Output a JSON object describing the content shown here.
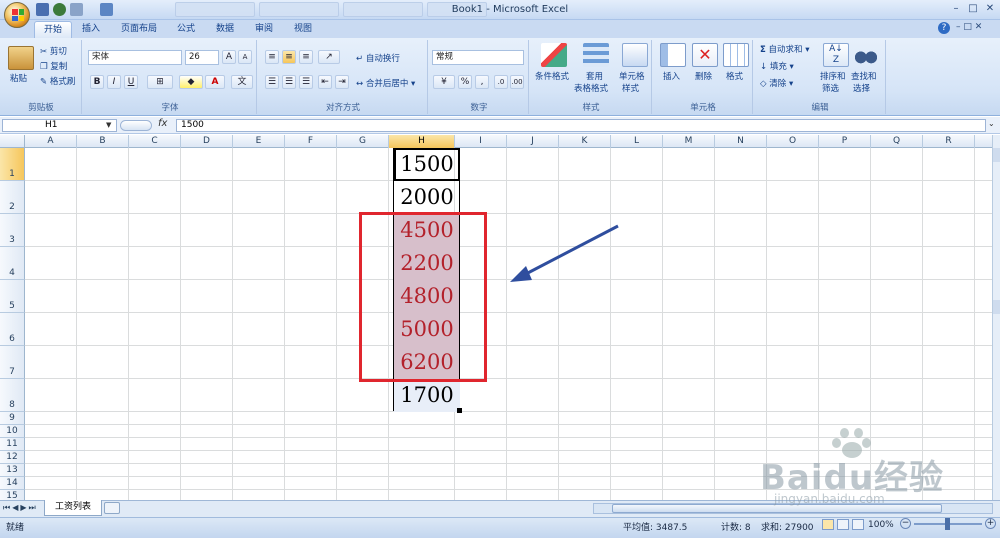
{
  "window": {
    "title": "Book1 - Microsoft Excel",
    "help_icon": "help-icon",
    "controls": [
      "minimize",
      "restore",
      "close"
    ]
  },
  "tabs": [
    "开始",
    "插入",
    "页面布局",
    "公式",
    "数据",
    "审阅",
    "视图"
  ],
  "active_tab": "开始",
  "ribbon": {
    "clipboard": {
      "paste": "粘贴",
      "cut": "剪切",
      "copy": "复制",
      "format_painter": "格式刷",
      "group_label": "剪贴板"
    },
    "font": {
      "font_name": "宋体",
      "font_size": "26",
      "bold": "B",
      "italic": "I",
      "underline": "U",
      "group_label": "字体"
    },
    "alignment": {
      "wrap_text": "自动换行",
      "merge_center": "合并后居中",
      "group_label": "对齐方式"
    },
    "number": {
      "format": "常规",
      "percent": "%",
      "comma": ",",
      "group_label": "数字"
    },
    "styles": {
      "conditional_format": "条件格式",
      "table_format_1": "套用",
      "table_format_2": "表格格式",
      "cell_styles_1": "单元格",
      "cell_styles_2": "样式",
      "group_label": "样式"
    },
    "cells": {
      "insert": "插入",
      "delete": "删除",
      "format": "格式",
      "group_label": "单元格"
    },
    "editing": {
      "autosum": "自动求和",
      "fill": "填充",
      "clear": "清除",
      "sort_1": "排序和",
      "sort_2": "筛选",
      "find_1": "查找和",
      "find_2": "选择",
      "group_label": "编辑"
    }
  },
  "formula_bar": {
    "name_box": "H1",
    "fx": "fx",
    "formula": "1500"
  },
  "columns": [
    "A",
    "B",
    "C",
    "D",
    "E",
    "F",
    "G",
    "H",
    "I",
    "J",
    "K",
    "L",
    "M",
    "N",
    "O",
    "P",
    "Q",
    "R"
  ],
  "selected_column": "H",
  "rows": [
    "1",
    "2",
    "3",
    "4",
    "5",
    "6",
    "7",
    "8",
    "9",
    "10",
    "11",
    "12",
    "13",
    "14",
    "15"
  ],
  "cells": {
    "H1": "1500",
    "H2": "2000",
    "H3": "4500",
    "H4": "2200",
    "H5": "4800",
    "H6": "5000",
    "H7": "6200",
    "H8": "1700"
  },
  "highlighted_cells": [
    "H3",
    "H4",
    "H5",
    "H6",
    "H7"
  ],
  "highlight_color": "#b3212b",
  "annotation_color": "#e0262e",
  "sheet_tab": "工资列表",
  "status": {
    "mode": "就绪",
    "average": "平均值: 3487.5",
    "count": "计数: 8",
    "sum": "求和: 27900",
    "zoom": "100%"
  },
  "watermark": {
    "brand": "Baidu经验",
    "url": "jingyan.baidu.com"
  }
}
